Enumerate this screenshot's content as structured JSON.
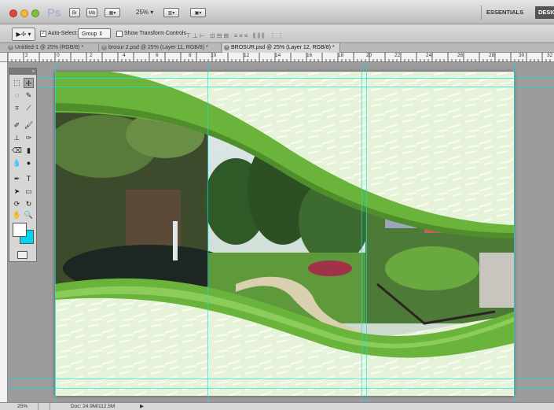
{
  "app": {
    "logo": "Ps",
    "zoom": "25%",
    "essentials": "ESSENTIALS",
    "design": "DESIG",
    "mb_label": "Mb"
  },
  "options": {
    "auto_select_label": "Auto-Select:",
    "auto_select_checked": true,
    "auto_select_value": "Group",
    "show_transform_label": "Show Transform Controls",
    "show_transform_checked": false
  },
  "tabs": [
    {
      "label": "Untitled-1 @ 25% (RGB/8) *",
      "active": false
    },
    {
      "label": "brosur 2.psd @ 25% (Layer 11, RGB/8) *",
      "active": false
    },
    {
      "label": "BROSUR.psd @ 25% (Layer 12, RGB/8) *",
      "active": true
    }
  ],
  "ruler": {
    "h_labels": [
      "2",
      "0",
      "2",
      "4",
      "6",
      "8",
      "10",
      "12",
      "14",
      "16",
      "18",
      "20",
      "22",
      "24",
      "26",
      "28",
      "30",
      "32"
    ]
  },
  "status": {
    "zoom": "25%",
    "doc": "Doc: 24.9M/112.5M"
  },
  "swatches": {
    "foreground": "#ffffff",
    "background": "#00d5ee"
  },
  "colors": {
    "brochure_green": "#6ab43c",
    "paper_tint": "#eaf5dc"
  }
}
